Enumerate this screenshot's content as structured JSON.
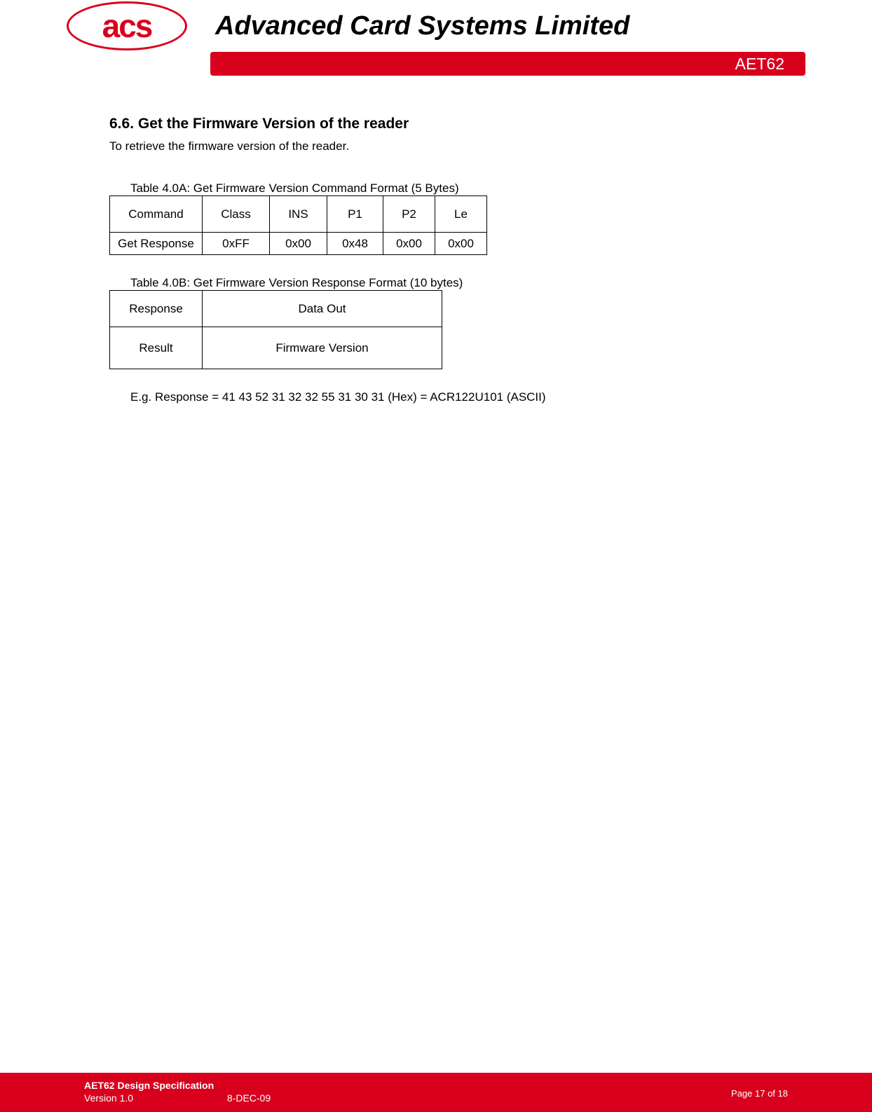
{
  "header": {
    "logo_text": "acs",
    "company_name": "Advanced Card Systems Limited",
    "product": "AET62"
  },
  "section": {
    "heading": "6.6. Get the Firmware Version of the reader",
    "intro": "To retrieve the firmware version of the reader."
  },
  "tableA": {
    "caption": "Table 4.0A: Get Firmware Version Command Format (5 Bytes)",
    "row1": [
      "Command",
      "Class",
      "INS",
      "P1",
      "P2",
      "Le"
    ],
    "row2": [
      "Get Response",
      "0xFF",
      "0x00",
      "0x48",
      "0x00",
      "0x00"
    ]
  },
  "tableB": {
    "caption": "Table 4.0B: Get Firmware Version Response Format (10 bytes)",
    "row1": [
      "Response",
      "Data Out"
    ],
    "row2": [
      "Result",
      "Firmware Version"
    ]
  },
  "example": "E.g. Response = 41 43 52 31 32 32 55 31 30 31 (Hex) = ACR122U101 (ASCII)",
  "footer": {
    "title": "AET62 Design Specification",
    "version": "Version 1.0",
    "date": "8-DEC-09",
    "page": "Page 17 of 18"
  }
}
